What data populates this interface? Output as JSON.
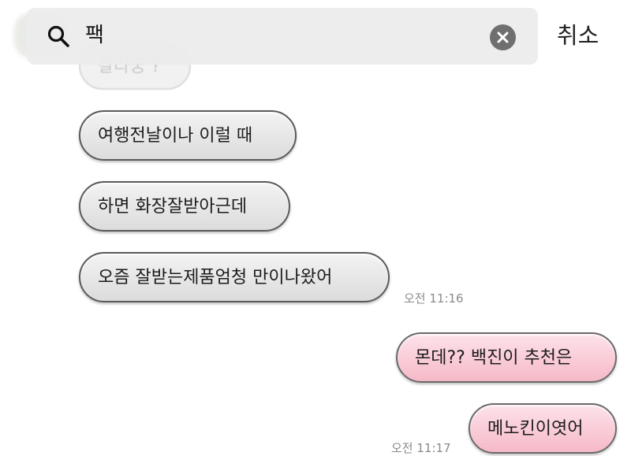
{
  "search": {
    "query": "팩",
    "cancel_label": "취소"
  },
  "messages": [
    {
      "text": "살라궁 ?",
      "direction": "incoming"
    },
    {
      "text": "여행전날이나 이럴 때",
      "direction": "incoming"
    },
    {
      "text": "하면 화장잘받아근데",
      "direction": "incoming"
    },
    {
      "text": "오즘 잘받는제품엄청 만이나왔어",
      "direction": "incoming"
    },
    {
      "text": "몬데?? 백진이 추천은",
      "direction": "outgoing"
    },
    {
      "text": "메노킨이엿어",
      "direction": "outgoing"
    }
  ],
  "timestamps": {
    "incoming_last": "오전 11:16",
    "outgoing_last": "오전 11:17"
  },
  "colors": {
    "incoming_bubble": "#e4e4e4",
    "outgoing_bubble": "#f8c6d3",
    "clear_button": "#6f6f6f"
  },
  "icons": {
    "search": "search-icon",
    "clear": "clear-icon"
  }
}
